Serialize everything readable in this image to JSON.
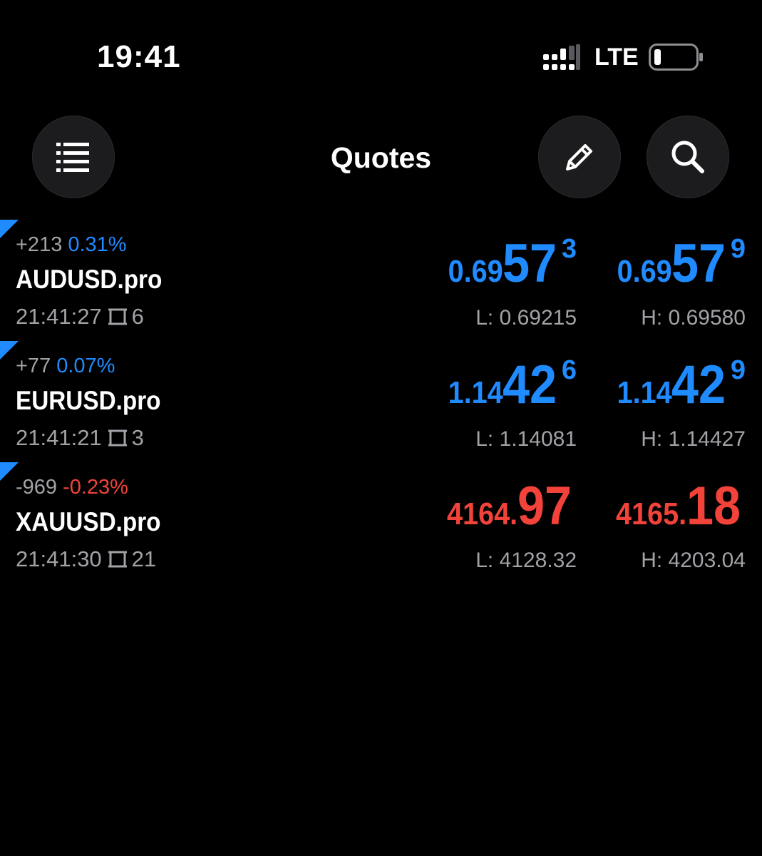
{
  "status_bar": {
    "time": "19:41",
    "network": "LTE",
    "signal_icon": "signal-icon",
    "battery_icon": "battery-icon"
  },
  "header": {
    "title": "Quotes",
    "menu_icon": "list-icon",
    "edit_icon": "pencil-icon",
    "search_icon": "search-icon"
  },
  "colors": {
    "up": "#1f8bff",
    "down": "#f2433a",
    "muted": "#a2a2a7",
    "background": "#000000",
    "button": "#1c1c1e"
  },
  "quotes": [
    {
      "symbol": "AUDUSD.pro",
      "change_points": "+213",
      "change_pct": "0.31%",
      "direction": "up",
      "time": "21:41:27",
      "spread": "6",
      "bid": {
        "small": "0.69",
        "big": "57",
        "sup": "3"
      },
      "ask": {
        "small": "0.69",
        "big": "57",
        "sup": "9"
      },
      "low": "L: 0.69215",
      "high": "H: 0.69580"
    },
    {
      "symbol": "EURUSD.pro",
      "change_points": "+77",
      "change_pct": "0.07%",
      "direction": "up",
      "time": "21:41:21",
      "spread": "3",
      "bid": {
        "small": "1.14",
        "big": "42",
        "sup": "6"
      },
      "ask": {
        "small": "1.14",
        "big": "42",
        "sup": "9"
      },
      "low": "L: 1.14081",
      "high": "H: 1.14427"
    },
    {
      "symbol": "XAUUSD.pro",
      "change_points": "-969",
      "change_pct": "-0.23%",
      "direction": "down",
      "time": "21:41:30",
      "spread": "21",
      "bid": {
        "small": "4164.",
        "big": "97",
        "sup": ""
      },
      "ask": {
        "small": "4165.",
        "big": "18",
        "sup": ""
      },
      "low": "L: 4128.32",
      "high": "H: 4203.04"
    }
  ]
}
